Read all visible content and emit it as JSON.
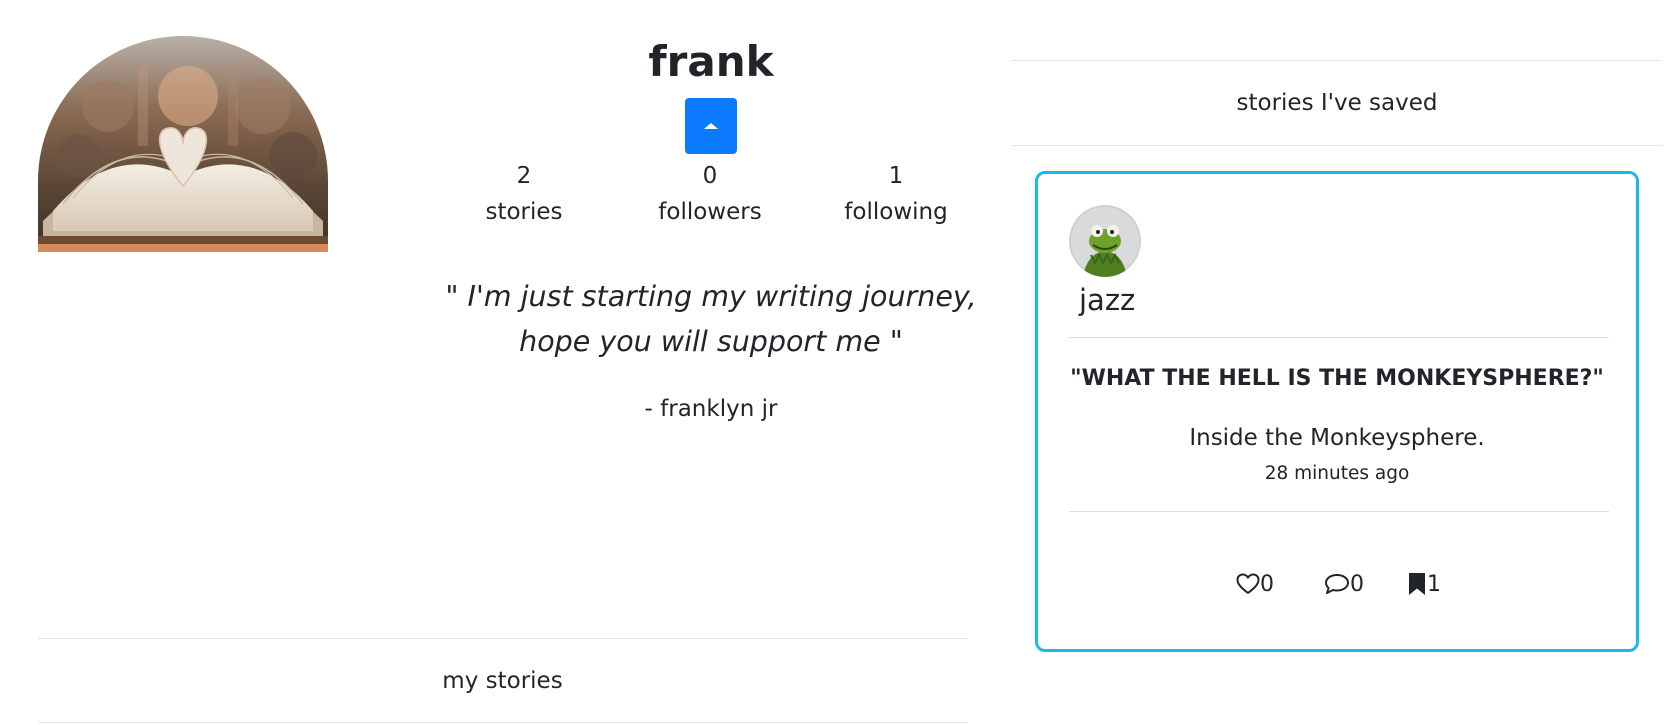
{
  "profile": {
    "name": "frank",
    "stats": [
      {
        "value": "2",
        "label": "stories"
      },
      {
        "value": "0",
        "label": "followers"
      },
      {
        "value": "1",
        "label": "following"
      }
    ],
    "bio": "\" I'm just starting my writing journey, hope you will support me \"",
    "bio_author": "- franklyn jr",
    "avatar_icon": "open-book-photo",
    "toggle_icon": "caret-up-icon"
  },
  "tabs": {
    "my_stories": "my stories",
    "saved": "stories I've saved"
  },
  "saved_story": {
    "author": "jazz",
    "author_avatar": "kermit-frog-photo",
    "title": "\"WHAT THE HELL IS THE MONKEYSPHERE?\"",
    "summary": "Inside the Monkeysphere.",
    "time": "28 minutes ago",
    "likes": "0",
    "comments": "0",
    "bookmarks": "1"
  },
  "colors": {
    "accent": "#0d7bff",
    "card_border": "#1ab8ec",
    "text": "#212529"
  }
}
